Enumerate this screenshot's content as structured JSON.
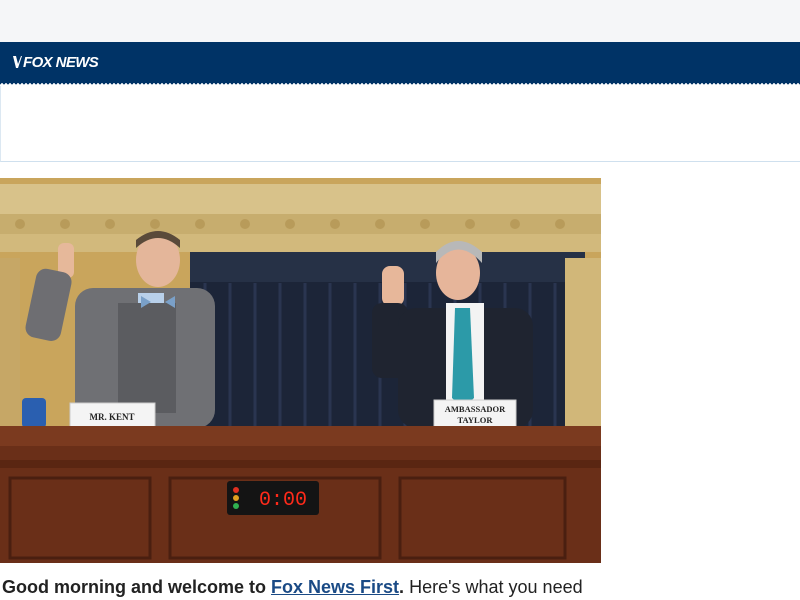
{
  "brand": {
    "logo_text": "FOX NEWS",
    "color": "#003366"
  },
  "hero": {
    "placard_left": "MR. KENT",
    "placard_right_line1": "AMBASSADOR",
    "placard_right_line2": "TAYLOR",
    "timer": "0:00"
  },
  "intro": {
    "lead": "Good morning and welcome to ",
    "link": "Fox News First",
    "period": ".",
    "rest": " Here's what you need"
  }
}
